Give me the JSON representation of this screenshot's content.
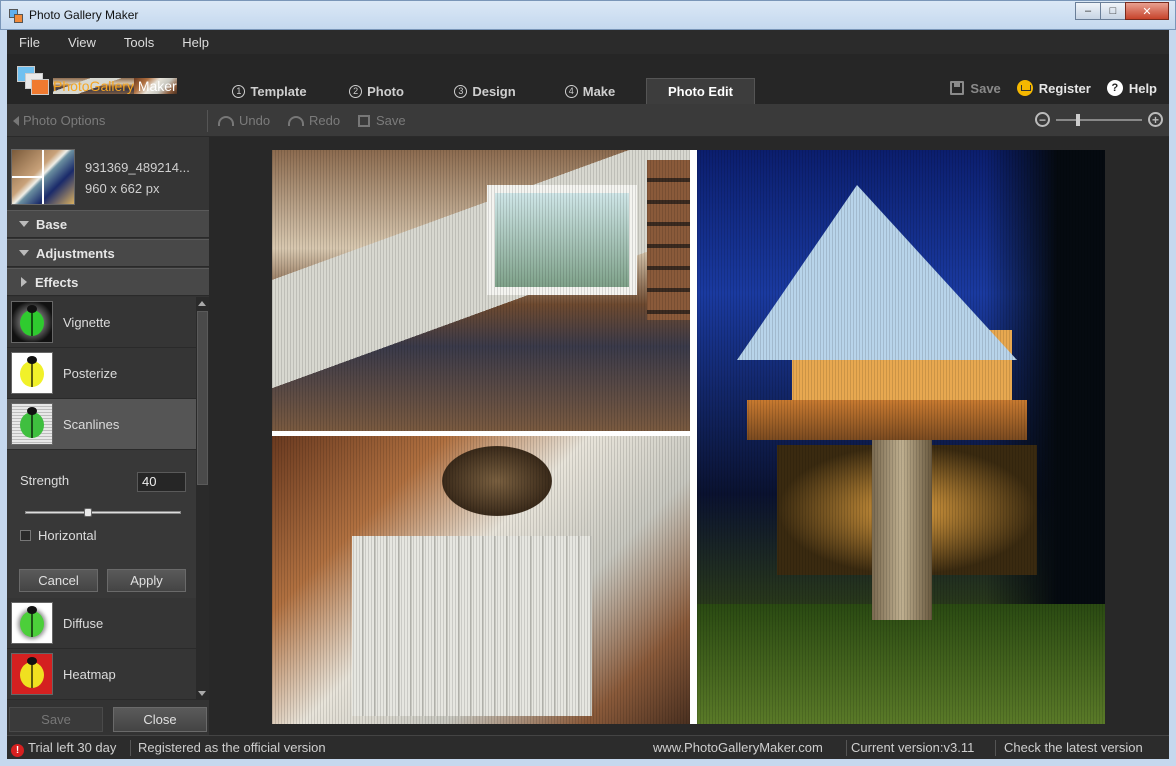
{
  "window": {
    "title": "Photo Gallery Maker"
  },
  "menu": [
    "File",
    "View",
    "Tools",
    "Help"
  ],
  "logo": {
    "part1": "PhotoGallery",
    "part2": " Maker"
  },
  "tabs": [
    {
      "num": "1",
      "label": "Template"
    },
    {
      "num": "2",
      "label": "Photo"
    },
    {
      "num": "3",
      "label": "Design"
    },
    {
      "num": "4",
      "label": "Make"
    },
    {
      "label": "Photo Edit",
      "active": true
    }
  ],
  "header_actions": {
    "save": "Save",
    "register": "Register",
    "help": "Help"
  },
  "toolbar": {
    "photo_options": "Photo Options",
    "undo": "Undo",
    "redo": "Redo",
    "save": "Save"
  },
  "thumb": {
    "filename": "931369_489214...",
    "dimensions": "960 x 662 px"
  },
  "sections": {
    "base": "Base",
    "adjustments": "Adjustments",
    "effects": "Effects"
  },
  "effects": [
    {
      "name": "Vignette",
      "icon": "vignette-bug-icon"
    },
    {
      "name": "Posterize",
      "icon": "posterize-bug-icon"
    },
    {
      "name": "Scanlines",
      "icon": "scanlines-bug-icon",
      "selected": true
    },
    {
      "name": "Diffuse",
      "icon": "diffuse-bug-icon"
    },
    {
      "name": "Heatmap",
      "icon": "heatmap-bug-icon"
    }
  ],
  "settings": {
    "strength_label": "Strength",
    "strength_value": "40",
    "horizontal_label": "Horizontal",
    "horizontal_checked": false,
    "cancel": "Cancel",
    "apply": "Apply"
  },
  "panel_buttons": {
    "save": "Save",
    "close": "Close"
  },
  "status": {
    "trial": "Trial left 30 day",
    "registered": "Registered as the official version",
    "website": "www.PhotoGalleryMaker.com",
    "version": "Current version:v3.11",
    "check": "Check the latest version"
  },
  "colors": {
    "accent_orange": "#f5a623",
    "panel_bg": "#333333",
    "active_effect": "#555555"
  }
}
